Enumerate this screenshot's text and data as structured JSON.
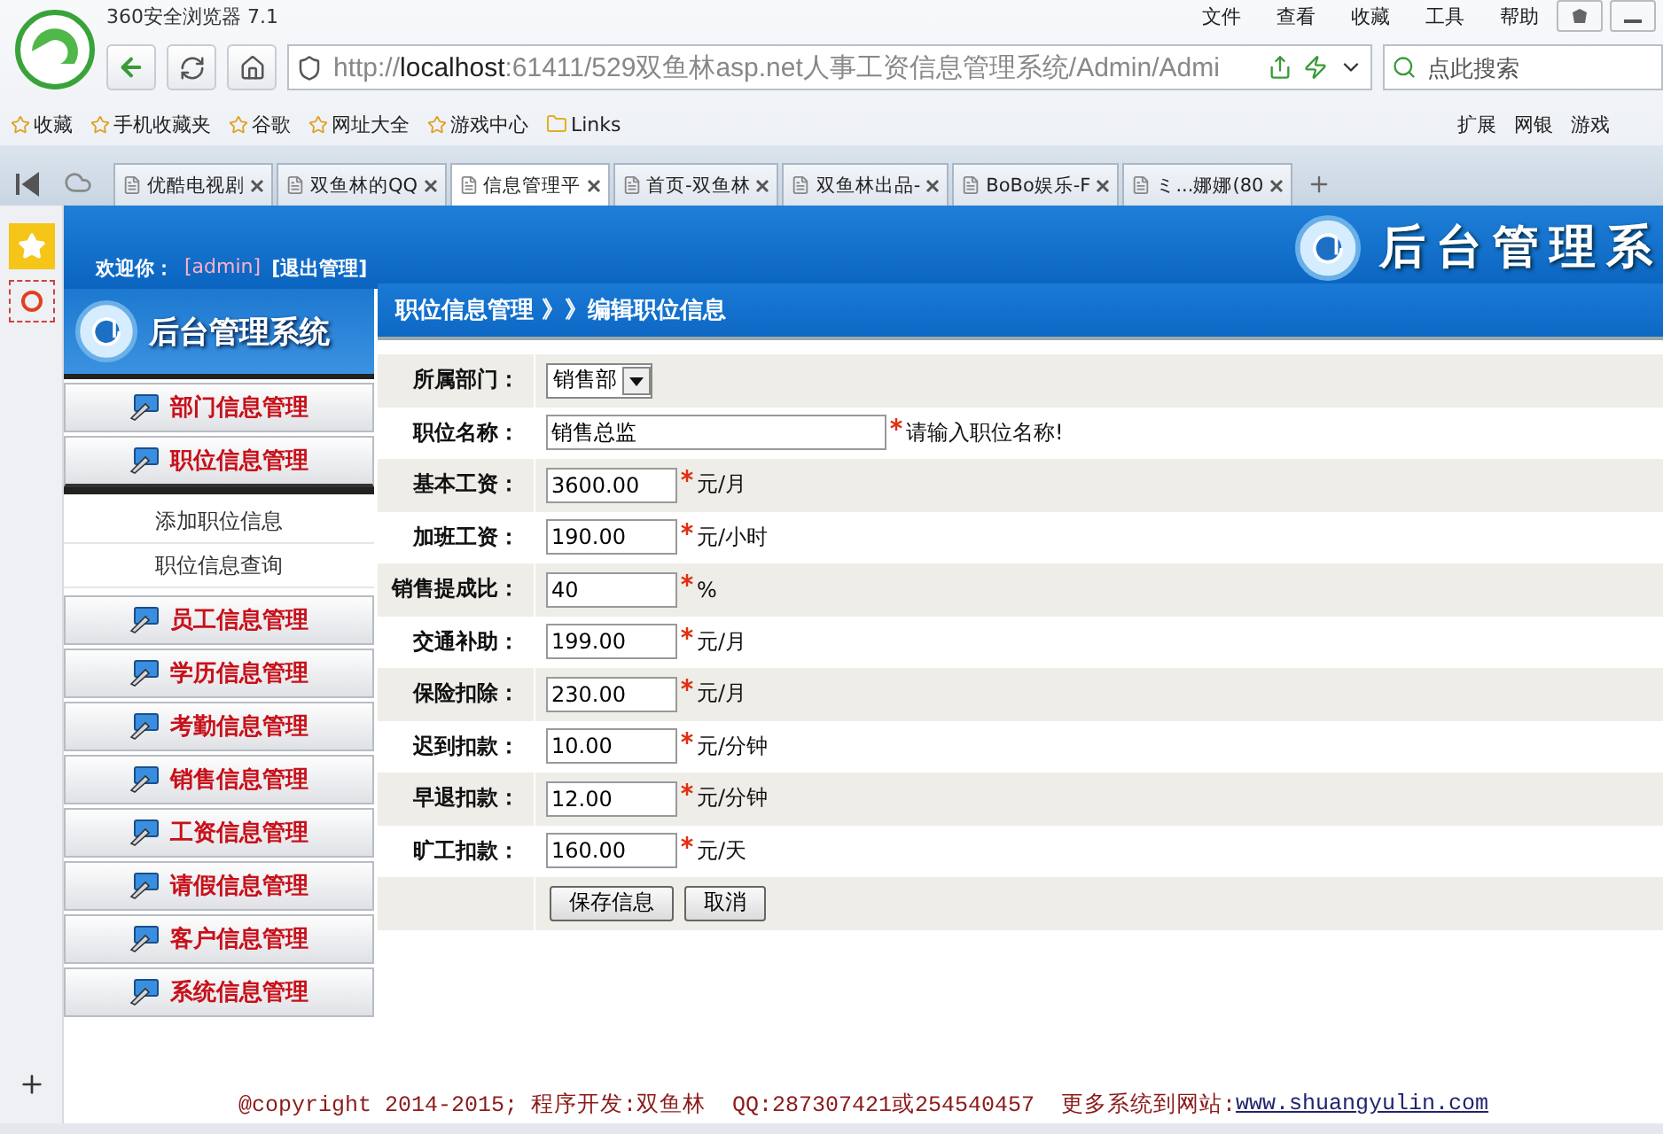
{
  "browser": {
    "title": "360安全浏览器 7.1",
    "menu": [
      "文件",
      "查看",
      "收藏",
      "工具",
      "帮助"
    ],
    "url": {
      "scheme": "http://",
      "host": "localhost",
      "rest": ":61411/529双鱼林asp.net人事工资信息管理系统/Admin/Admi"
    },
    "search": {
      "placeholder": "点此搜索"
    },
    "bookmarks": [
      "收藏",
      "手机收藏夹",
      "谷歌",
      "网址大全",
      "游戏中心",
      "Links"
    ],
    "bookmarks_right": [
      "扩展",
      "网银",
      "游戏"
    ],
    "tabs": [
      {
        "label": "优酷电视剧",
        "selected": false
      },
      {
        "label": "双鱼林的QQ",
        "selected": false
      },
      {
        "label": "信息管理平",
        "selected": true
      },
      {
        "label": "首页-双鱼林",
        "selected": false
      },
      {
        "label": "双鱼林出品-",
        "selected": false
      },
      {
        "label": "BoBo娱乐-F",
        "selected": false
      },
      {
        "label": "ミ...娜娜(80",
        "selected": false
      }
    ]
  },
  "header": {
    "welcome": "欢迎你：",
    "user": "[admin]",
    "logout": "[退出管理]",
    "logo_text": "后台管理系"
  },
  "sidebar": {
    "logo_text": "后台管理系统",
    "items": [
      {
        "label": "部门信息管理",
        "expanded": false
      },
      {
        "label": "职位信息管理",
        "expanded": true,
        "children": [
          "添加职位信息",
          "职位信息查询"
        ]
      },
      {
        "label": "员工信息管理",
        "expanded": false
      },
      {
        "label": "学历信息管理",
        "expanded": false
      },
      {
        "label": "考勤信息管理",
        "expanded": false
      },
      {
        "label": "销售信息管理",
        "expanded": false
      },
      {
        "label": "工资信息管理",
        "expanded": false
      },
      {
        "label": "请假信息管理",
        "expanded": false
      },
      {
        "label": "客户信息管理",
        "expanded": false
      },
      {
        "label": "系统信息管理",
        "expanded": false
      }
    ]
  },
  "breadcrumb": "职位信息管理 》》编辑职位信息",
  "form": {
    "fields": [
      {
        "kind": "select",
        "label": "所属部门：",
        "value": "销售部"
      },
      {
        "kind": "long_text",
        "label": "职位名称：",
        "value": "销售总监",
        "required": true,
        "unit": "请输入职位名称!"
      },
      {
        "kind": "text",
        "label": "基本工资：",
        "value": "3600.00",
        "required": true,
        "unit": "元/月"
      },
      {
        "kind": "text",
        "label": "加班工资：",
        "value": "190.00",
        "required": true,
        "unit": "元/小时"
      },
      {
        "kind": "text",
        "label": "销售提成比：",
        "value": "40",
        "required": true,
        "unit": "%"
      },
      {
        "kind": "text",
        "label": "交通补助：",
        "value": "199.00",
        "required": true,
        "unit": "元/月"
      },
      {
        "kind": "text",
        "label": "保险扣除：",
        "value": "230.00",
        "required": true,
        "unit": "元/月"
      },
      {
        "kind": "text",
        "label": "迟到扣款：",
        "value": "10.00",
        "required": true,
        "unit": "元/分钟"
      },
      {
        "kind": "text",
        "label": "早退扣款：",
        "value": "12.00",
        "required": true,
        "unit": "元/分钟"
      },
      {
        "kind": "text",
        "label": "旷工扣款：",
        "value": "160.00",
        "required": true,
        "unit": "元/天"
      }
    ],
    "buttons": [
      "保存信息",
      "取消"
    ]
  },
  "footer": {
    "text": "@copyright 2014-2015; 程序开发:双鱼林  QQ:287307421或254540457  更多系统到网站:",
    "link": "www.shuangyulin.com"
  }
}
